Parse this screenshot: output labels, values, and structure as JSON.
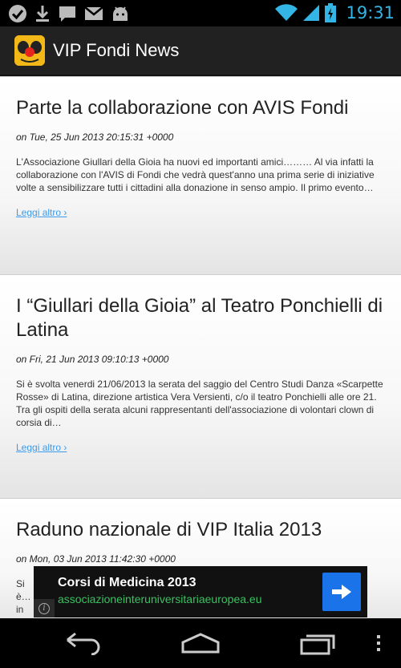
{
  "status_bar": {
    "time": "19:31",
    "accent_color": "#33b5e5",
    "notification_icons": [
      "check-icon",
      "download-icon",
      "chat-icon",
      "gmail-icon",
      "android-icon"
    ],
    "system_icons": [
      "wifi-icon",
      "signal-icon",
      "battery-charging-icon"
    ]
  },
  "action_bar": {
    "title": "VIP Fondi News",
    "icon": "clown-app-icon"
  },
  "posts": [
    {
      "title": "Parte la collaborazione con AVIS Fondi",
      "date": "on Tue, 25 Jun 2013 20:15:31 +0000",
      "excerpt": "L'Associazione Giullari della Gioia ha nuovi ed importanti amici……… Al via infatti la collaborazione con l'AVIS di Fondi che vedrà quest'anno una prima serie di iniziative volte a sensibilizzare tutti i cittadini alla donazione in senso ampio. Il primo evento…",
      "read_more": "Leggi altro ›"
    },
    {
      "title": "I “Giullari della Gioia” al Teatro Ponchielli di Latina",
      "date": "on Fri, 21 Jun 2013 09:10:13 +0000",
      "excerpt": "Si è svolta venerdi 21/06/2013 la serata del saggio del Centro Studi Danza «Scarpette Rosse» di Latina, direzione artistica Vera Versienti,  c/o il teatro Ponchielli alle ore 21. Tra gli ospiti della serata alcuni rappresentanti dell'associazione di volontari clown di corsia di…",
      "read_more": "Leggi altro ›"
    },
    {
      "title": "Raduno nazionale di VIP Italia 2013",
      "date": "on Mon, 03 Jun 2013 11:42:30 +0000",
      "excerpt": "Si è… in p… il ra…",
      "read_more": ""
    }
  ],
  "ad": {
    "title": "Corsi di Medicina 2013",
    "url": "associazioneinteruniversitariaeuropea.eu",
    "url_color": "#37c25f",
    "button_color": "#1a73e8",
    "arrow_icon": "arrow-right-icon",
    "info_icon": "info-icon"
  },
  "nav_bar": {
    "buttons": [
      "back-icon",
      "home-icon",
      "recent-apps-icon",
      "overflow-menu-icon"
    ]
  }
}
